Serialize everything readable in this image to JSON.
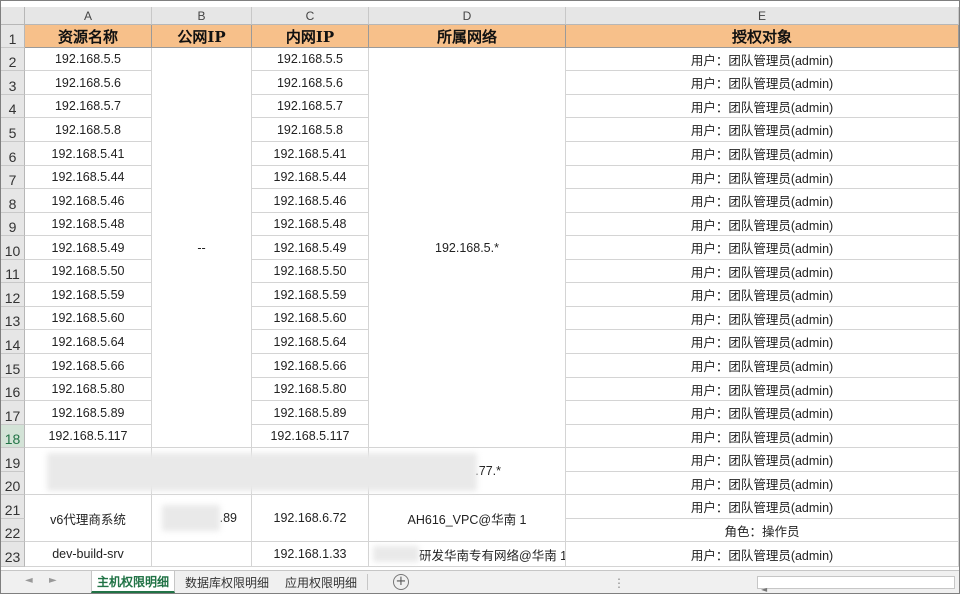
{
  "columns": [
    "A",
    "B",
    "C",
    "D",
    "E"
  ],
  "header_row": {
    "row_num": "1",
    "resource_name": "资源名称",
    "public_ip": "公网IP",
    "private_ip": "内网IP",
    "network": "所属网络",
    "auth_target": "授权对象"
  },
  "rows": [
    {
      "num": "2",
      "name": "192.168.5.5",
      "private": "192.168.5.5",
      "auth": "用户：团队管理员(admin)"
    },
    {
      "num": "3",
      "name": "192.168.5.6",
      "private": "192.168.5.6",
      "auth": "用户：团队管理员(admin)"
    },
    {
      "num": "4",
      "name": "192.168.5.7",
      "private": "192.168.5.7",
      "auth": "用户：团队管理员(admin)"
    },
    {
      "num": "5",
      "name": "192.168.5.8",
      "private": "192.168.5.8",
      "auth": "用户：团队管理员(admin)"
    },
    {
      "num": "6",
      "name": "192.168.5.41",
      "private": "192.168.5.41",
      "auth": "用户：团队管理员(admin)"
    },
    {
      "num": "7",
      "name": "192.168.5.44",
      "private": "192.168.5.44",
      "auth": "用户：团队管理员(admin)"
    },
    {
      "num": "8",
      "name": "192.168.5.46",
      "private": "192.168.5.46",
      "auth": "用户：团队管理员(admin)"
    },
    {
      "num": "9",
      "name": "192.168.5.48",
      "private": "192.168.5.48",
      "auth": "用户：团队管理员(admin)"
    },
    {
      "num": "10",
      "name": "192.168.5.49",
      "private": "192.168.5.49",
      "auth": "用户：团队管理员(admin)"
    },
    {
      "num": "11",
      "name": "192.168.5.50",
      "private": "192.168.5.50",
      "auth": "用户：团队管理员(admin)"
    },
    {
      "num": "12",
      "name": "192.168.5.59",
      "private": "192.168.5.59",
      "auth": "用户：团队管理员(admin)"
    },
    {
      "num": "13",
      "name": "192.168.5.60",
      "private": "192.168.5.60",
      "auth": "用户：团队管理员(admin)"
    },
    {
      "num": "14",
      "name": "192.168.5.64",
      "private": "192.168.5.64",
      "auth": "用户：团队管理员(admin)"
    },
    {
      "num": "15",
      "name": "192.168.5.66",
      "private": "192.168.5.66",
      "auth": "用户：团队管理员(admin)"
    },
    {
      "num": "16",
      "name": "192.168.5.80",
      "private": "192.168.5.80",
      "auth": "用户：团队管理员(admin)"
    },
    {
      "num": "17",
      "name": "192.168.5.89",
      "private": "192.168.5.89",
      "auth": "用户：团队管理员(admin)"
    },
    {
      "num": "18",
      "name": "192.168.5.117",
      "private": "192.168.5.117",
      "auth": "用户：团队管理员(admin)"
    }
  ],
  "merged_public_ip_2_18": "--",
  "merged_network_2_18": "192.168.5.*",
  "row19_20": {
    "num_a": "19",
    "num_b": "20",
    "network_suffix": ".77.*",
    "auth_a": "用户：团队管理员(admin)",
    "auth_b": "用户：团队管理员(admin)"
  },
  "row21_22": {
    "num_a": "21",
    "num_b": "22",
    "name": "v6代理商系统",
    "public_suffix": ".89",
    "private": "192.168.6.72",
    "network": "AH616_VPC@华南 1",
    "auth_a": "用户：团队管理员(admin)",
    "auth_b": "角色：操作员"
  },
  "row23": {
    "num": "23",
    "name": "dev-build-srv",
    "private": "192.168.1.33",
    "network": "研发华南专有网络@华南 1",
    "auth": "用户：团队管理员(admin)"
  },
  "active_row": "18",
  "sheet_tabs": [
    "主机权限明细",
    "数据库权限明细",
    "应用权限明细"
  ],
  "active_tab": "主机权限明细",
  "add_sheet_label": "+",
  "nav_left": "◄",
  "nav_right": "►",
  "scroll_left": "◄",
  "colors": {
    "header_fill": "#f7c08a",
    "active_green": "#217346"
  }
}
